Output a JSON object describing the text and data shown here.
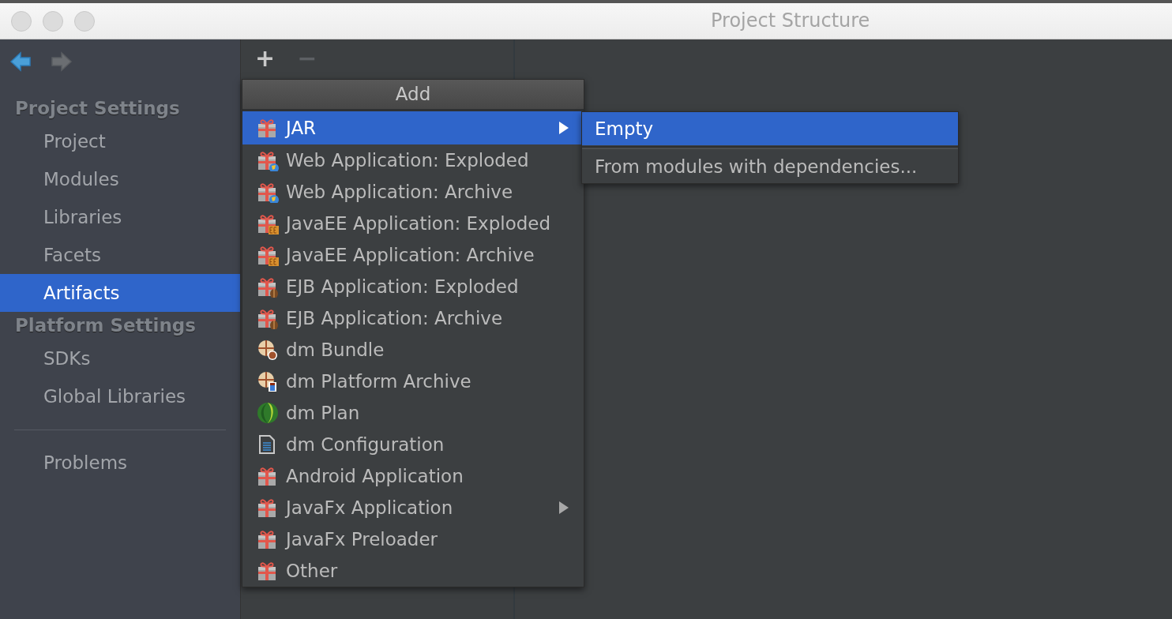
{
  "window": {
    "title": "Project Structure"
  },
  "navigation": {
    "back_enabled": true,
    "forward_enabled": false
  },
  "sidebar": {
    "sections": [
      {
        "heading": "Project Settings",
        "items": [
          {
            "label": "Project",
            "selected": false
          },
          {
            "label": "Modules",
            "selected": false
          },
          {
            "label": "Libraries",
            "selected": false
          },
          {
            "label": "Facets",
            "selected": false
          },
          {
            "label": "Artifacts",
            "selected": true
          }
        ]
      },
      {
        "heading": "Platform Settings",
        "items": [
          {
            "label": "SDKs",
            "selected": false
          },
          {
            "label": "Global Libraries",
            "selected": false
          }
        ]
      }
    ],
    "extra_items": [
      {
        "label": "Problems",
        "selected": false
      }
    ]
  },
  "toolbar": {
    "buttons": [
      {
        "label": "+",
        "disabled": false
      },
      {
        "label": "−",
        "disabled": true
      }
    ]
  },
  "add_menu": {
    "title": "Add",
    "items": [
      {
        "label": "JAR",
        "kind": "gift",
        "selected": true,
        "has_submenu": true
      },
      {
        "label": "Web Application: Exploded",
        "kind": "gift-globe",
        "selected": false,
        "has_submenu": false
      },
      {
        "label": "Web Application: Archive",
        "kind": "gift-globe",
        "selected": false,
        "has_submenu": false
      },
      {
        "label": "JavaEE Application: Exploded",
        "kind": "gift-ee",
        "selected": false,
        "has_submenu": false
      },
      {
        "label": "JavaEE Application: Archive",
        "kind": "gift-ee",
        "selected": false,
        "has_submenu": false
      },
      {
        "label": "EJB Application: Exploded",
        "kind": "gift-bean",
        "selected": false,
        "has_submenu": false
      },
      {
        "label": "EJB Application: Archive",
        "kind": "gift-bean",
        "selected": false,
        "has_submenu": false
      },
      {
        "label": "dm Bundle",
        "kind": "bundle",
        "selected": false,
        "has_submenu": false
      },
      {
        "label": "dm Platform Archive",
        "kind": "platform",
        "selected": false,
        "has_submenu": false
      },
      {
        "label": "dm Plan",
        "kind": "plan",
        "selected": false,
        "has_submenu": false
      },
      {
        "label": "dm Configuration",
        "kind": "document",
        "selected": false,
        "has_submenu": false
      },
      {
        "label": "Android Application",
        "kind": "gift",
        "selected": false,
        "has_submenu": false
      },
      {
        "label": "JavaFx Application",
        "kind": "gift",
        "selected": false,
        "has_submenu": true
      },
      {
        "label": "JavaFx Preloader",
        "kind": "gift",
        "selected": false,
        "has_submenu": false
      },
      {
        "label": "Other",
        "kind": "gift",
        "selected": false,
        "has_submenu": false
      }
    ]
  },
  "submenu": {
    "items": [
      {
        "label": "Empty",
        "selected": true
      },
      {
        "label": "From modules with dependencies...",
        "selected": false
      }
    ]
  }
}
